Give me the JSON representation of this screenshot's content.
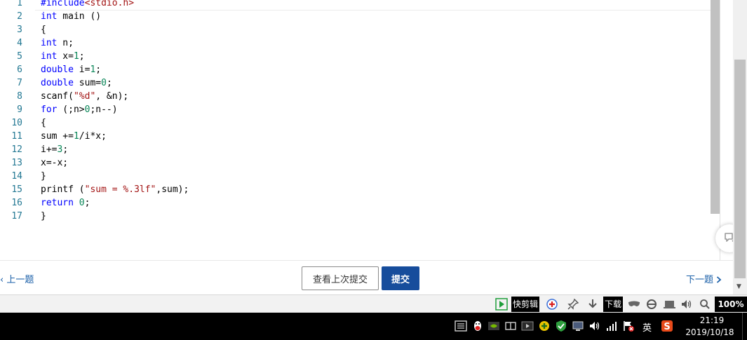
{
  "editor": {
    "lines": [
      {
        "n": "1",
        "tokens": [
          {
            "t": "#include",
            "c": "inc"
          },
          {
            "t": "<stdio.h>",
            "c": "angle"
          }
        ]
      },
      {
        "n": "2",
        "tokens": [
          {
            "t": "int",
            "c": "kw"
          },
          {
            "t": " main ()",
            "c": ""
          }
        ]
      },
      {
        "n": "3",
        "tokens": [
          {
            "t": "{",
            "c": ""
          }
        ]
      },
      {
        "n": "4",
        "tokens": [
          {
            "t": "int",
            "c": "kw"
          },
          {
            "t": " n;",
            "c": ""
          }
        ]
      },
      {
        "n": "5",
        "tokens": [
          {
            "t": "int",
            "c": "kw"
          },
          {
            "t": " x=",
            "c": ""
          },
          {
            "t": "1",
            "c": "num"
          },
          {
            "t": ";",
            "c": ""
          }
        ]
      },
      {
        "n": "6",
        "tokens": [
          {
            "t": "double",
            "c": "kw"
          },
          {
            "t": " i=",
            "c": ""
          },
          {
            "t": "1",
            "c": "num"
          },
          {
            "t": ";",
            "c": ""
          }
        ]
      },
      {
        "n": "7",
        "tokens": [
          {
            "t": "double",
            "c": "kw"
          },
          {
            "t": " sum=",
            "c": ""
          },
          {
            "t": "0",
            "c": "num"
          },
          {
            "t": ";",
            "c": ""
          }
        ]
      },
      {
        "n": "8",
        "tokens": [
          {
            "t": "scanf(",
            "c": ""
          },
          {
            "t": "\"%d\"",
            "c": "str"
          },
          {
            "t": ", &n);",
            "c": ""
          }
        ]
      },
      {
        "n": "9",
        "tokens": [
          {
            "t": "for",
            "c": "kw"
          },
          {
            "t": " (;n>",
            "c": ""
          },
          {
            "t": "0",
            "c": "num"
          },
          {
            "t": ";n--)",
            "c": ""
          }
        ]
      },
      {
        "n": "10",
        "tokens": [
          {
            "t": "{",
            "c": ""
          }
        ]
      },
      {
        "n": "11",
        "tokens": [
          {
            "t": "sum +=",
            "c": ""
          },
          {
            "t": "1",
            "c": "num"
          },
          {
            "t": "/i*x;",
            "c": ""
          }
        ]
      },
      {
        "n": "12",
        "tokens": [
          {
            "t": "i+=",
            "c": ""
          },
          {
            "t": "3",
            "c": "num"
          },
          {
            "t": ";",
            "c": ""
          }
        ]
      },
      {
        "n": "13",
        "tokens": [
          {
            "t": "x=-x;",
            "c": ""
          }
        ]
      },
      {
        "n": "14",
        "tokens": [
          {
            "t": "}",
            "c": ""
          }
        ]
      },
      {
        "n": "15",
        "tokens": [
          {
            "t": "printf (",
            "c": ""
          },
          {
            "t": "\"sum = %.3lf\"",
            "c": "str"
          },
          {
            "t": ",sum);",
            "c": ""
          }
        ]
      },
      {
        "n": "16",
        "tokens": [
          {
            "t": "return",
            "c": "kw"
          },
          {
            "t": " ",
            "c": ""
          },
          {
            "t": "0",
            "c": "num"
          },
          {
            "t": ";",
            "c": ""
          }
        ]
      },
      {
        "n": "17",
        "tokens": [
          {
            "t": "}",
            "c": ""
          }
        ]
      }
    ]
  },
  "nav": {
    "prev_label": "上一题",
    "history_label": "查看上次提交",
    "submit_label": "提交",
    "next_label": "下一题"
  },
  "status_bar": {
    "clip_label": "快剪辑",
    "download_label": "下载",
    "zoom": "100%"
  },
  "taskbar": {
    "ime": "英",
    "time": "21:19",
    "date": "2019/10/18"
  },
  "colors": {
    "keyword": "#0000ff",
    "number": "#098658",
    "string": "#a31515",
    "line_number": "#237893",
    "submit_bg": "#174d9c",
    "link": "#1a5fa8"
  }
}
